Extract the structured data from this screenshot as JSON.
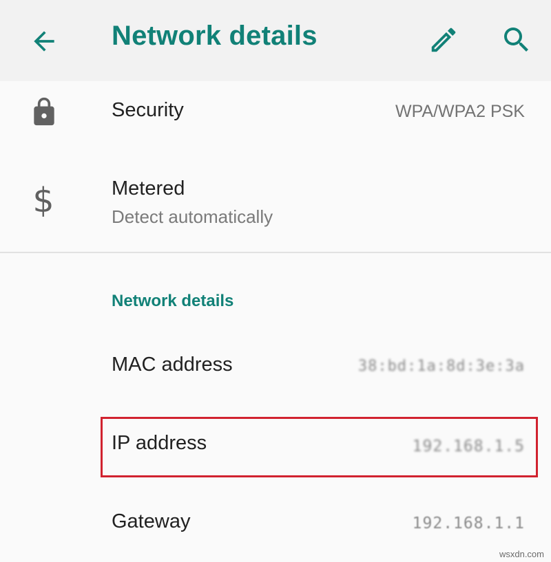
{
  "app_bar": {
    "title": "Network details",
    "back_icon": "arrow-left-icon",
    "edit_icon": "pencil-icon",
    "search_icon": "search-icon",
    "accent_color": "#118177"
  },
  "rows": {
    "security": {
      "label": "Security",
      "value": "WPA/WPA2 PSK",
      "icon": "lock-icon"
    },
    "metered": {
      "label": "Metered",
      "summary": "Detect automatically",
      "icon": "dollar-icon"
    }
  },
  "network_section": {
    "header": "Network details",
    "mac": {
      "label": "MAC address",
      "value": "38:bd:1a:8d:3e:3a"
    },
    "ip": {
      "label": "IP address",
      "value": "192.168.1.5"
    },
    "gateway": {
      "label": "Gateway",
      "value": "192.168.1.1"
    }
  },
  "highlight_color": "#d1222f",
  "watermark": "wsxdn.com"
}
